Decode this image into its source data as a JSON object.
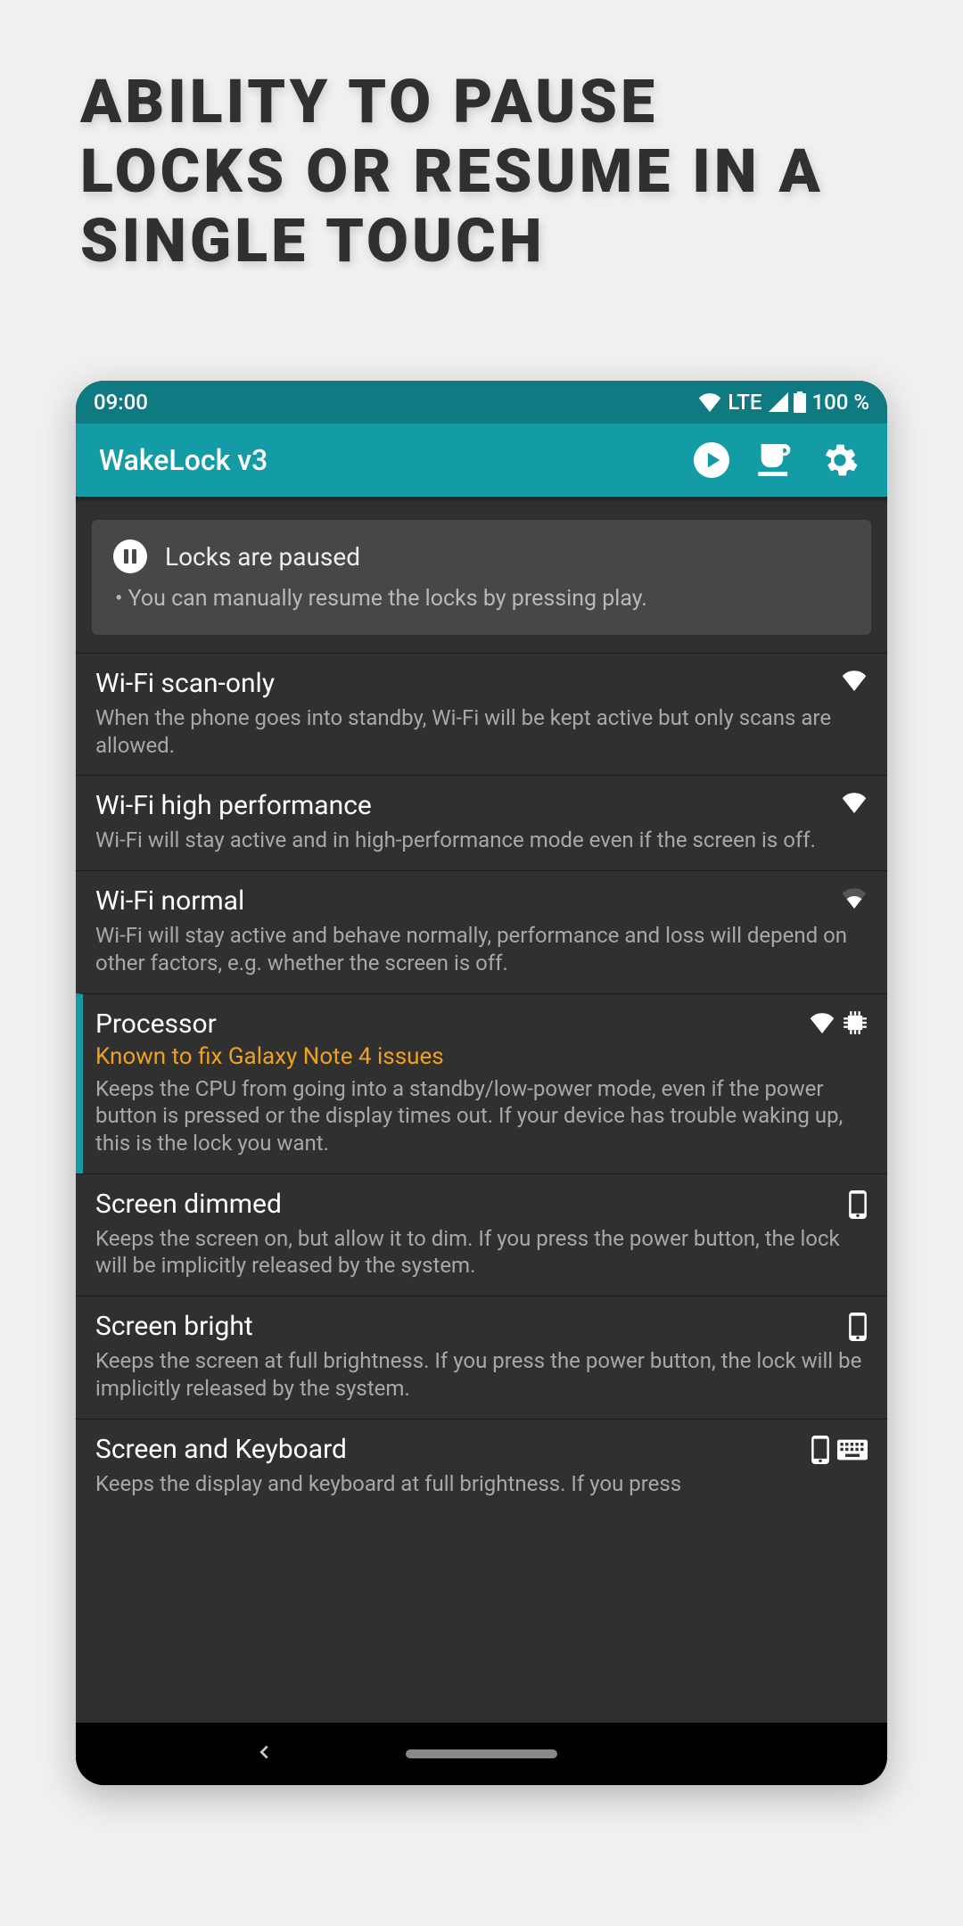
{
  "promo_title": "Ability to pause locks or resume in a single touch",
  "statusbar": {
    "time": "09:00",
    "lte": "LTE",
    "battery": "100 %"
  },
  "toolbar": {
    "title": "WakeLock v3"
  },
  "banner": {
    "title": "Locks are paused",
    "subtitle": "• You can manually resume the locks by pressing play."
  },
  "items": [
    {
      "title": "Wi-Fi scan-only",
      "desc": "When the phone goes into standby, Wi-Fi will be kept active but only scans are allowed.",
      "icons": [
        "wifi"
      ],
      "selected": false
    },
    {
      "title": "Wi-Fi high performance",
      "desc": "Wi-Fi will stay active and in high-performance mode even if the screen is off.",
      "icons": [
        "wifi"
      ],
      "selected": false
    },
    {
      "title": "Wi-Fi normal",
      "desc": "Wi-Fi will stay active and behave normally, performance and loss will depend on other factors, e.g. whether the screen is off.",
      "icons": [
        "wifi-dim"
      ],
      "selected": false
    },
    {
      "title": "Processor",
      "note": "Known to fix Galaxy Note 4 issues",
      "desc": "Keeps the CPU from going into a standby/low-power mode, even if the power button is pressed or the display times out. If your device has trouble waking up, this is the lock you want.",
      "icons": [
        "wifi",
        "cpu"
      ],
      "selected": true
    },
    {
      "title": "Screen dimmed",
      "desc": "Keeps the screen on, but allow it to dim. If you press the power button, the lock will be implicitly released by the system.",
      "icons": [
        "phone"
      ],
      "selected": false
    },
    {
      "title": "Screen bright",
      "desc": "Keeps the screen at full brightness. If you press the power button, the lock will be implicitly released by the system.",
      "icons": [
        "phone"
      ],
      "selected": false
    },
    {
      "title": "Screen and Keyboard",
      "desc": "Keeps the display and keyboard at full brightness. If you press",
      "icons": [
        "phone",
        "keyboard"
      ],
      "selected": false
    }
  ]
}
